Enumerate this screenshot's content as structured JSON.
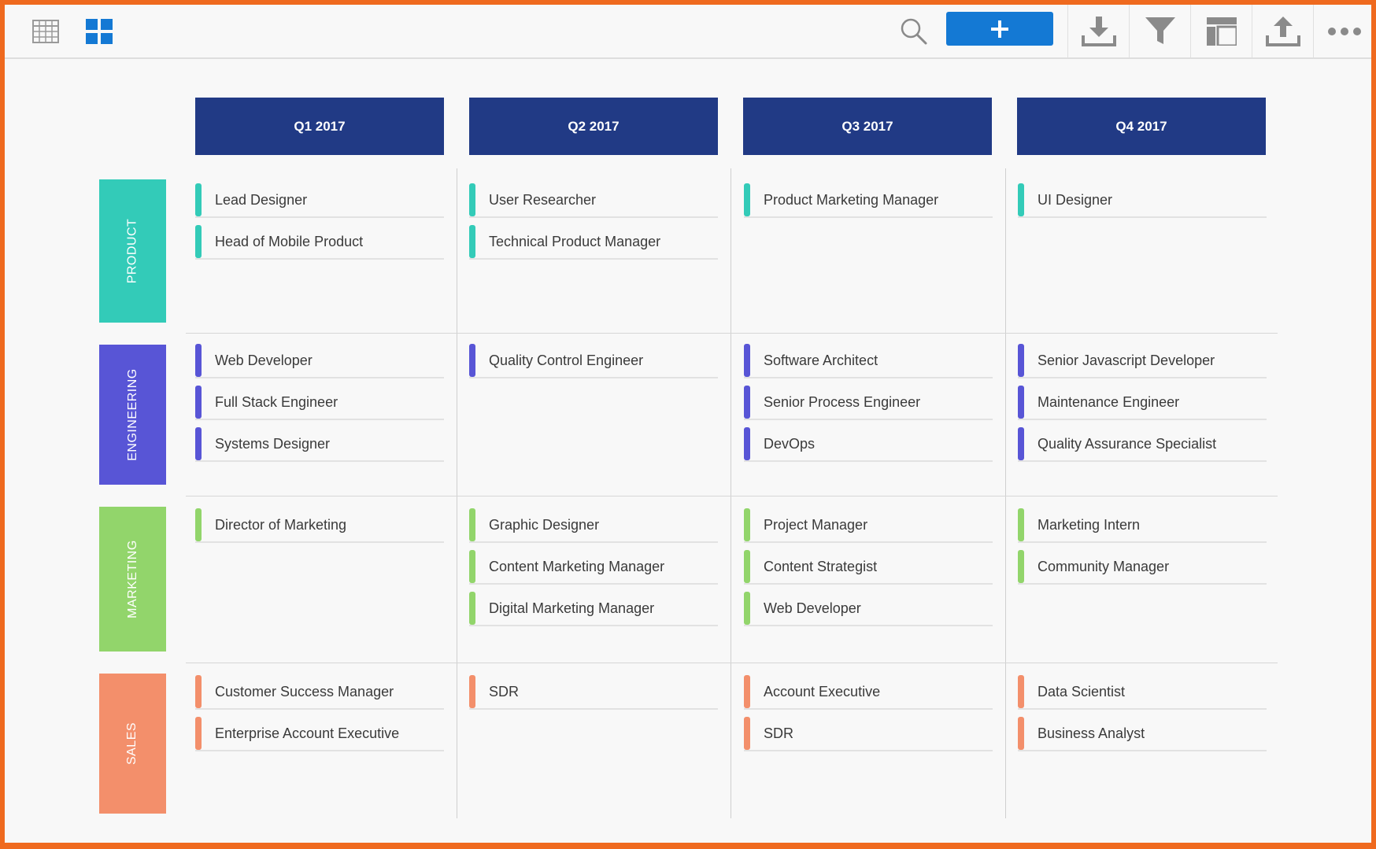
{
  "toolbar": {
    "icons": [
      "table-view-icon",
      "card-view-icon",
      "search-icon",
      "plus-icon",
      "download-icon",
      "filter-icon",
      "layout-icon",
      "upload-icon",
      "more-icon"
    ],
    "accent": "#1479d4"
  },
  "quarters": [
    "Q1 2017",
    "Q2 2017",
    "Q3 2017",
    "Q4 2017"
  ],
  "header_color": "#213a85",
  "lanes": [
    {
      "label": "PRODUCT",
      "color": "#33cbb8",
      "cells": [
        [
          "Lead Designer",
          "Head of Mobile Product"
        ],
        [
          "User Researcher",
          "Technical Product Manager"
        ],
        [
          "Product Marketing Manager"
        ],
        [
          "UI Designer"
        ]
      ]
    },
    {
      "label": "ENGINEERING",
      "color": "#5855d6",
      "cells": [
        [
          "Web Developer",
          "Full Stack Engineer",
          "Systems Designer"
        ],
        [
          "Quality Control Engineer"
        ],
        [
          "Software Architect",
          "Senior Process Engineer",
          "DevOps"
        ],
        [
          "Senior Javascript Developer",
          "Maintenance Engineer",
          "Quality Assurance Specialist"
        ]
      ]
    },
    {
      "label": "MARKETING",
      "color": "#92d56b",
      "cells": [
        [
          "Director of Marketing"
        ],
        [
          "Graphic Designer",
          "Content Marketing Manager",
          "Digital Marketing Manager"
        ],
        [
          "Project Manager",
          "Content Strategist",
          "Web Developer"
        ],
        [
          "Marketing Intern",
          "Community Manager"
        ]
      ]
    },
    {
      "label": "SALES",
      "color": "#f38f6b",
      "cells": [
        [
          "Customer Success Manager",
          "Enterprise Account Executive"
        ],
        [
          "SDR"
        ],
        [
          "Account Executive",
          "SDR"
        ],
        [
          "Data Scientist",
          "Business Analyst"
        ]
      ]
    }
  ]
}
